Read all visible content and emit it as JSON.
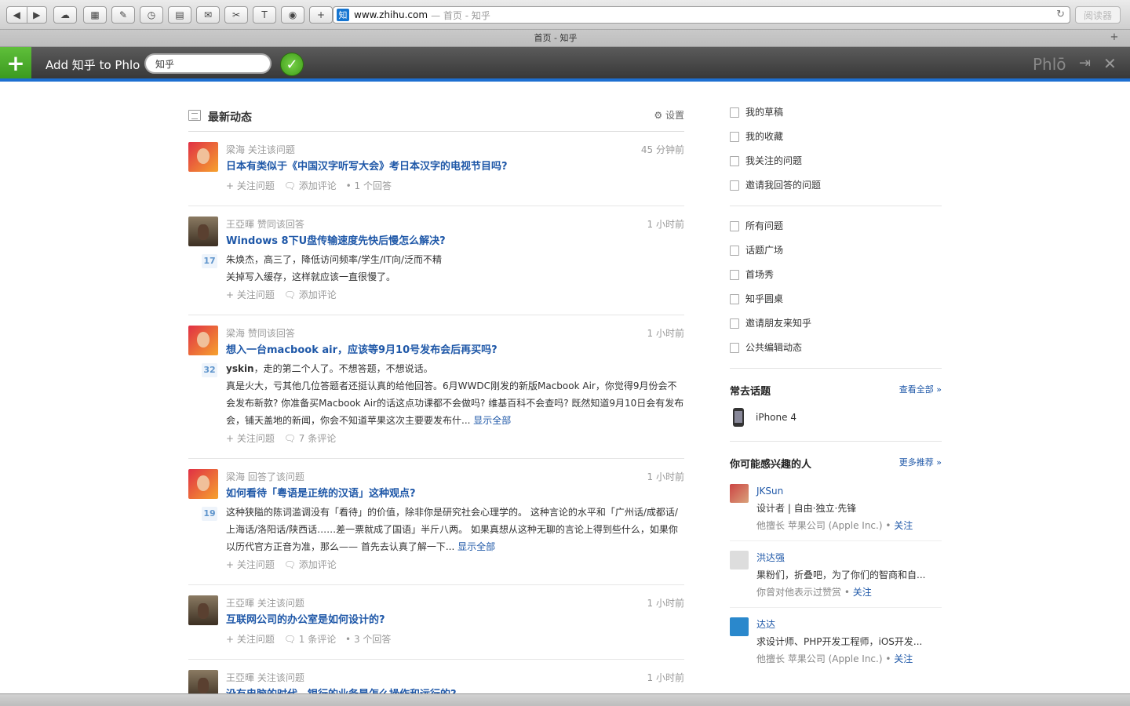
{
  "browser": {
    "url_host": "www.zhihu.com",
    "url_title": "— 首页 - 知乎",
    "reader_label": "阅读器",
    "tab_title": "首页 - 知乎",
    "favicon_char": "知",
    "new_tab_label": "+"
  },
  "phlo": {
    "add_label": "Add 知乎 to Phlo",
    "input_value": "知乎",
    "brand": "Phlō"
  },
  "feed": {
    "title": "最新动态",
    "settings_label": "设置",
    "items": [
      {
        "meta": "梁海 关注该问题",
        "time": "45 分钟前",
        "title": "日本有类似于《中国汉字听写大会》考日本汉字的电视节目吗?",
        "actions": [
          "+ 关注问题",
          "添加评论",
          "• 1 个回答"
        ]
      },
      {
        "meta": "王亞暉 赞同该回答",
        "time": "1 小时前",
        "title": "Windows 8下U盘传输速度先快后慢怎么解决?",
        "votes": "17",
        "answer_lines": [
          "朱焕杰，高三了，降低访问频率/学生/IT向/泛而不精",
          "关掉写入缓存，这样就应该一直很慢了。"
        ],
        "actions": [
          "+ 关注问题",
          "添加评论"
        ]
      },
      {
        "meta": "梁海 赞同该回答",
        "time": "1 小时前",
        "title": "想入一台macbook air，应该等9月10号发布会后再买吗?",
        "votes": "32",
        "answer_author": "yskin",
        "answer_author_rest": "，走的第二个人了。不想答题，不想说话。",
        "answer_text": "真是火大，亏其他几位答题者还挺认真的给他回答。6月WWDC刚发的新版Macbook Air，你觉得9月份会不会发布新款? 你准备买Macbook Air的话这点功课都不会做吗? 维基百科不会查吗? 既然知道9月10日会有发布会，铺天盖地的新闻，你会不知道苹果这次主要要发布什...",
        "show_all": "显示全部",
        "actions": [
          "+ 关注问题",
          "7 条评论"
        ]
      },
      {
        "meta": "梁海 回答了该问题",
        "time": "1 小时前",
        "title": "如何看待「粤语是正统的汉语」这种观点?",
        "votes": "19",
        "answer_text": "这种狭隘的陈词滥调没有「看待」的价值，除非你是研究社会心理学的。 这种言论的水平和「广州话/成都话/上海话/洛阳话/陕西话……差一票就成了国语」半斤八两。 如果真想从这种无聊的言论上得到些什么，如果你以历代官方正音为准，那么——  首先去认真了解一下...",
        "show_all": "显示全部",
        "actions": [
          "+ 关注问题",
          "添加评论"
        ]
      },
      {
        "meta": "王亞暉 关注该问题",
        "time": "1 小时前",
        "title": "互联网公司的办公室是如何设计的?",
        "actions": [
          "+ 关注问题",
          "1 条评论",
          "• 3 个回答"
        ]
      },
      {
        "meta": "王亞暉 关注该问题",
        "time": "1 小时前",
        "title": "没有电脑的时代，银行的业务是怎么操作和运行的?"
      }
    ]
  },
  "sidebar": {
    "nav1": [
      "我的草稿",
      "我的收藏",
      "我关注的问题",
      "邀请我回答的问题"
    ],
    "nav2": [
      "所有问题",
      "话题广场",
      "首场秀",
      "知乎圆桌",
      "邀请朋友来知乎",
      "公共编辑动态"
    ],
    "topics_title": "常去话题",
    "topics_link": "查看全部 »",
    "topics": [
      "iPhone 4"
    ],
    "people_title": "你可能感兴趣的人",
    "people_link": "更多推荐 »",
    "people": [
      {
        "name": "JKSun",
        "desc": "设计者 | 自由·独立·先锋",
        "sub": "他擅长 苹果公司 (Apple Inc.) •",
        "follow": "关注"
      },
      {
        "name": "洪达强",
        "desc": "果粉们，折叠吧，为了你们的智商和自...",
        "sub": "你曾对他表示过赞赏 •",
        "follow": "关注"
      },
      {
        "name": "达达",
        "desc": "求设计师、PHP开发工程师，iOS开发...",
        "sub": "他擅长 苹果公司 (Apple Inc.) •",
        "follow": "关注"
      }
    ]
  }
}
